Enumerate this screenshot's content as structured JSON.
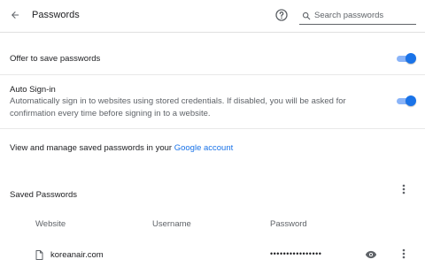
{
  "header": {
    "title": "Passwords",
    "search_placeholder": "Search passwords"
  },
  "settings": {
    "offer_to_save": {
      "label": "Offer to save passwords",
      "enabled": true
    },
    "auto_signin": {
      "label": "Auto Sign-in",
      "description_line1": "Automatically sign in to websites using stored credentials. If disabled, you will be asked for",
      "description_line2": "confirmation every time before signing in to a website.",
      "enabled": true
    },
    "manage": {
      "text": "View and manage saved passwords in your ",
      "link": "Google account"
    }
  },
  "saved_passwords": {
    "heading": "Saved Passwords",
    "columns": [
      "Website",
      "Username",
      "Password"
    ],
    "rows": [
      {
        "website": "koreanair.com",
        "username": "",
        "password": "••••••••••••••••"
      }
    ]
  },
  "colors": {
    "accent": "#1a73e8",
    "toggle_track": "#8ab4f8"
  }
}
